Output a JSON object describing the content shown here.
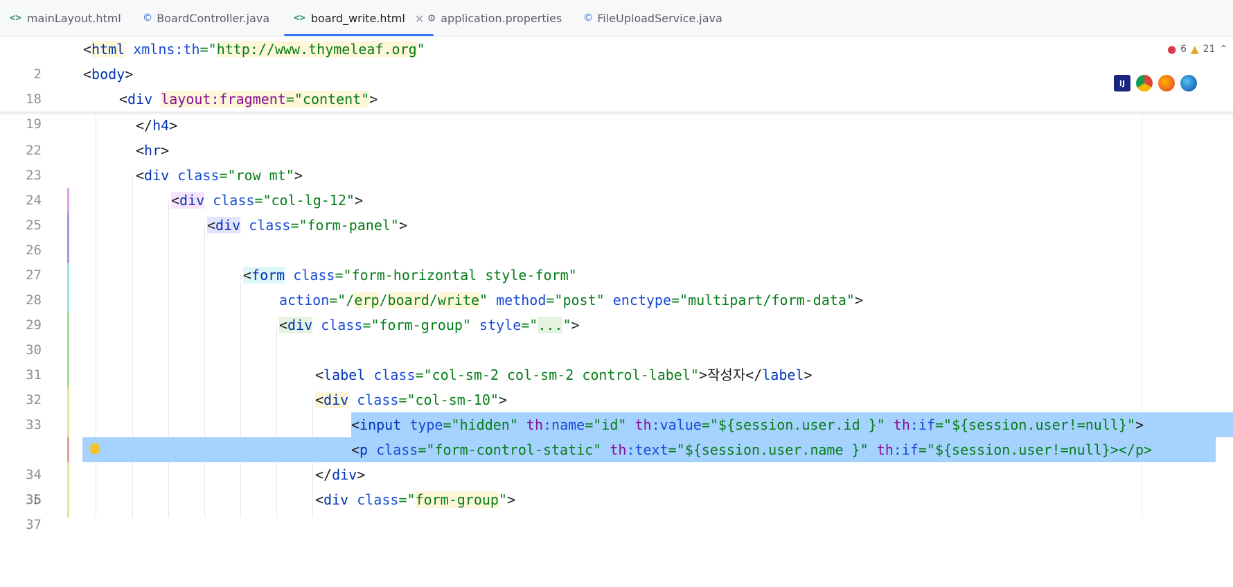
{
  "tabs": [
    {
      "icon": "<>",
      "label": "mainLayout.html"
    },
    {
      "icon": "©",
      "label": "BoardController.java"
    },
    {
      "icon": "<>",
      "label": "board_write.html",
      "close": "×"
    },
    {
      "icon": "⚙",
      "label": "application.properties"
    },
    {
      "icon": "©",
      "label": "FileUploadService.java"
    }
  ],
  "status": {
    "errors": "6",
    "warnings": "21"
  },
  "browsers": [
    "IJ",
    "Chrome",
    "Firefox",
    "Edge"
  ],
  "lines": [
    {
      "n": "2"
    },
    {
      "n": "18"
    },
    {
      "n": "19"
    },
    {
      "n": "22"
    },
    {
      "n": "23"
    },
    {
      "n": "24"
    },
    {
      "n": "25"
    },
    {
      "n": "26"
    },
    {
      "n": "27"
    },
    {
      "n": "28"
    },
    {
      "n": "29"
    },
    {
      "n": "30"
    },
    {
      "n": "31"
    },
    {
      "n": "32"
    },
    {
      "n": "33"
    },
    {
      "n": "34"
    },
    {
      "n": "35"
    },
    {
      "n": "36"
    },
    {
      "n": "37"
    }
  ]
}
